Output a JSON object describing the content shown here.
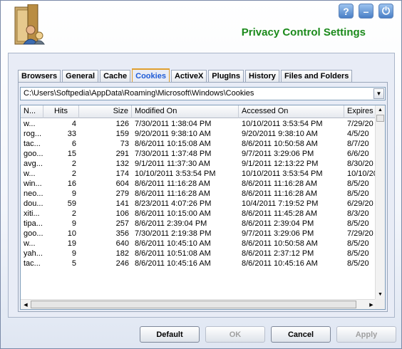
{
  "header": {
    "title": "Privacy Control Settings",
    "accent_color": "#1b8a1b",
    "icons": {
      "help": "help-icon",
      "minimize": "minimize-icon",
      "power": "power-icon",
      "logo": "cabinet-user-icon"
    },
    "help_glyph": "?",
    "minimize_glyph": "–",
    "power_glyph": "⏻"
  },
  "tabs": [
    {
      "label": "Browsers",
      "active": false
    },
    {
      "label": "General",
      "active": false
    },
    {
      "label": "Cache",
      "active": false
    },
    {
      "label": "Cookies",
      "active": true
    },
    {
      "label": "ActiveX",
      "active": false
    },
    {
      "label": "PlugIns",
      "active": false
    },
    {
      "label": "History",
      "active": false
    },
    {
      "label": "Files and Folders",
      "active": false
    }
  ],
  "path": {
    "value": "C:\\Users\\Softpedia\\AppData\\Roaming\\Microsoft\\Windows\\Cookies"
  },
  "list": {
    "columns": [
      "N...",
      "Hits",
      "Size",
      "Modified On",
      "Accessed On",
      "Expires"
    ],
    "rows": [
      [
        "w...",
        "4",
        "126",
        "7/30/2011 1:38:04 PM",
        "10/10/2011 3:53:54 PM",
        "7/29/20"
      ],
      [
        "rog...",
        "33",
        "159",
        "9/20/2011 9:38:10 AM",
        "9/20/2011 9:38:10 AM",
        "4/5/20"
      ],
      [
        "tac...",
        "6",
        "73",
        "8/6/2011 10:15:08 AM",
        "8/6/2011 10:50:58 AM",
        "8/7/20"
      ],
      [
        "goo...",
        "15",
        "291",
        "7/30/2011 1:37:48 PM",
        "9/7/2011 3:29:06 PM",
        "6/6/20"
      ],
      [
        "avg...",
        "2",
        "132",
        "9/1/2011 11:37:30 AM",
        "9/1/2011 12:13:22 PM",
        "8/30/20"
      ],
      [
        "w...",
        "2",
        "174",
        "10/10/2011 3:53:54 PM",
        "10/10/2011 3:53:54 PM",
        "10/10/20"
      ],
      [
        "win...",
        "16",
        "604",
        "8/6/2011 11:16:28 AM",
        "8/6/2011 11:16:28 AM",
        "8/5/20"
      ],
      [
        "neo...",
        "9",
        "279",
        "8/6/2011 11:16:28 AM",
        "8/6/2011 11:16:28 AM",
        "8/5/20"
      ],
      [
        "dou...",
        "59",
        "141",
        "8/23/2011 4:07:26 PM",
        "10/4/2011 7:19:52 PM",
        "6/29/20"
      ],
      [
        "xiti...",
        "2",
        "106",
        "8/6/2011 10:15:00 AM",
        "8/6/2011 11:45:28 AM",
        "8/3/20"
      ],
      [
        "tipa...",
        "9",
        "257",
        "8/6/2011 2:39:04 PM",
        "8/6/2011 2:39:04 PM",
        "8/5/20"
      ],
      [
        "goo...",
        "10",
        "356",
        "7/30/2011 2:19:38 PM",
        "9/7/2011 3:29:06 PM",
        "7/29/20"
      ],
      [
        "w...",
        "19",
        "640",
        "8/6/2011 10:45:10 AM",
        "8/6/2011 10:50:58 AM",
        "8/5/20"
      ],
      [
        "yah...",
        "9",
        "182",
        "8/6/2011 10:51:08 AM",
        "8/6/2011 2:37:12 PM",
        "8/5/20"
      ],
      [
        "tac...",
        "5",
        "246",
        "8/6/2011 10:45:16 AM",
        "8/6/2011 10:45:16 AM",
        "8/5/20"
      ]
    ]
  },
  "scroll_glyphs": {
    "up": "▲",
    "down": "▼",
    "left": "◀",
    "right": "▶",
    "dropdown": "▼"
  },
  "footer": {
    "default_label": "Default",
    "ok_label": "OK",
    "cancel_label": "Cancel",
    "apply_label": "Apply",
    "ok_enabled": false,
    "apply_enabled": false
  },
  "colors": {
    "active_tab_text": "#1e5bd6",
    "active_tab_border": "#e0a030"
  }
}
